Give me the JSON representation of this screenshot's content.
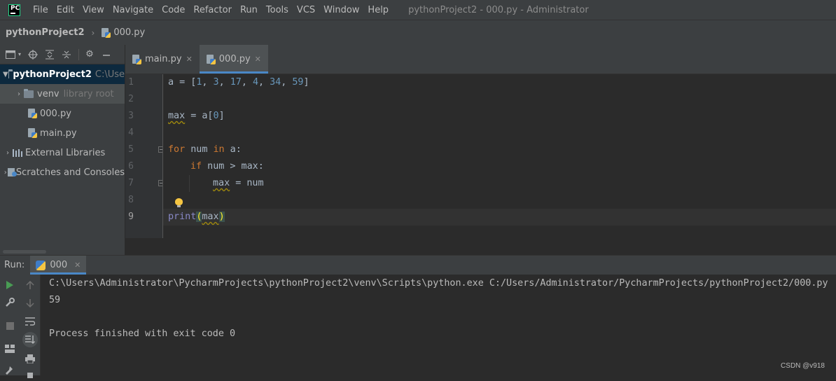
{
  "menubar": {
    "logo_text": "PC",
    "items": [
      "File",
      "Edit",
      "View",
      "Navigate",
      "Code",
      "Refactor",
      "Run",
      "Tools",
      "VCS",
      "Window",
      "Help"
    ],
    "window_title": "pythonProject2 - 000.py - Administrator"
  },
  "breadcrumb": {
    "project": "pythonProject2",
    "separator": "›",
    "file": "000.py"
  },
  "tabs": [
    {
      "label": "main.py",
      "active": false
    },
    {
      "label": "000.py",
      "active": true
    }
  ],
  "project_tree": {
    "root_name": "pythonProject2",
    "root_path": "C:\\Use",
    "venv_name": "venv",
    "venv_hint": "library root",
    "files": [
      "000.py",
      "main.py"
    ],
    "external_libraries": "External Libraries",
    "scratches": "Scratches and Consoles"
  },
  "editor": {
    "line_numbers": [
      "1",
      "2",
      "3",
      "4",
      "5",
      "6",
      "7",
      "8",
      "9"
    ],
    "current_line": 9,
    "code": {
      "l1_a": "a = [",
      "l1_n1": "1",
      "l1_n2": "3",
      "l1_n3": "17",
      "l1_n4": "4",
      "l1_n5": "34",
      "l1_n6": "59",
      "l1_sep": ", ",
      "l1_end": "]",
      "l3_var": "max",
      "l3_rest": " = a[",
      "l3_num": "0",
      "l3_end": "]",
      "l5_for": "for",
      "l5_mid": " num ",
      "l5_in": "in",
      "l5_end": " a:",
      "l6_if": "if",
      "l6_rest": " num > max:",
      "l7_var": "max",
      "l7_rest": " = num",
      "l9_print": "print",
      "l9_open": "(",
      "l9_arg": "max",
      "l9_close": ")"
    }
  },
  "run": {
    "label": "Run:",
    "tab_label": "000",
    "output": [
      "C:\\Users\\Administrator\\PycharmProjects\\pythonProject2\\venv\\Scripts\\python.exe C:/Users/Administrator/PycharmProjects/pythonProject2/000.py",
      "59",
      "",
      "Process finished with exit code 0"
    ]
  },
  "watermark": "CSDN @v918",
  "colors": {
    "background": "#2b2b2b",
    "panel": "#3c3f41",
    "keyword": "#cc7832",
    "number": "#6897bb",
    "builtin": "#8888c6",
    "accent": "#4a88c7",
    "run_green": "#499c54"
  }
}
